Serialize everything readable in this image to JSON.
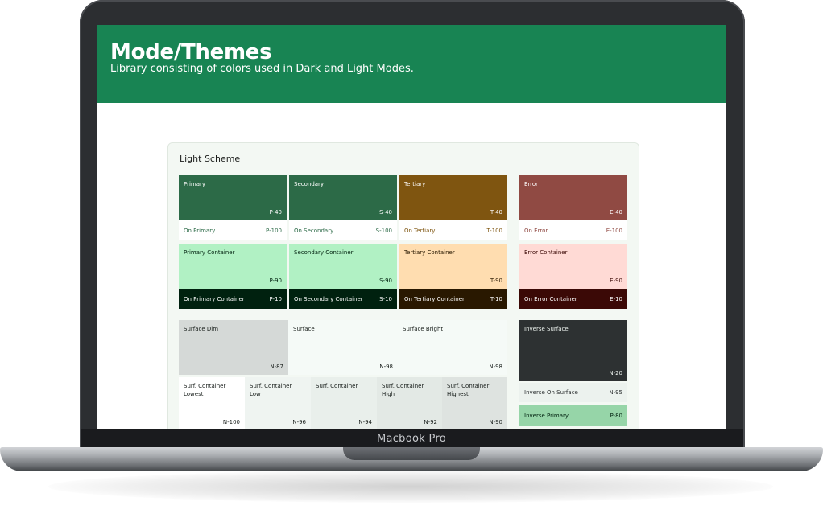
{
  "device_label": "Macbook Pro",
  "header": {
    "title": "Mode/Themes",
    "subtitle": "Library consisting of colors used in Dark and Light Modes."
  },
  "scheme": {
    "title": "Light Scheme",
    "primary": {
      "name": "Primary",
      "code": "P-40",
      "on_name": "On Primary",
      "on_code": "P-100",
      "container_name": "Primary Container",
      "container_code": "P-90",
      "on_container_name": "On Primary Container",
      "on_container_code": "P-10"
    },
    "secondary": {
      "name": "Secondary",
      "code": "S-40",
      "on_name": "On Secondary",
      "on_code": "S-100",
      "container_name": "Secondary Container",
      "container_code": "S-90",
      "on_container_name": "On Secondary Container",
      "on_container_code": "S-10"
    },
    "tertiary": {
      "name": "Tertiary",
      "code": "T-40",
      "on_name": "On Tertiary",
      "on_code": "T-100",
      "container_name": "Tertiary Container",
      "container_code": "T-90",
      "on_container_name": "On Tertiary Container",
      "on_container_code": "T-10"
    },
    "error": {
      "name": "Error",
      "code": "E-40",
      "on_name": "On Error",
      "on_code": "E-100",
      "container_name": "Error Container",
      "container_code": "E-90",
      "on_container_name": "On Error Container",
      "on_container_code": "E-10"
    },
    "surface": {
      "dim_name": "Surface Dim",
      "dim_code": "N-87",
      "name": "Surface",
      "code": "N-98",
      "bright_name": "Surface Bright",
      "bright_code": "N-98",
      "containers": [
        {
          "name": "Surf. Container Lowest",
          "code": "N-100"
        },
        {
          "name": "Surf. Container Low",
          "code": "N-96"
        },
        {
          "name": "Surf. Container",
          "code": "N-94"
        },
        {
          "name": "Surf. Container High",
          "code": "N-92"
        },
        {
          "name": "Surf. Container Highest",
          "code": "N-90"
        }
      ],
      "inverse_name": "Inverse Surface",
      "inverse_code": "N-20",
      "inverse_on_name": "Inverse On Surface",
      "inverse_on_code": "N-95",
      "inverse_primary_name": "Inverse Primary",
      "inverse_primary_code": "P-80"
    }
  },
  "colors": {
    "header_bg": "#188453",
    "primary": "#2c6a47",
    "on_primary": "#ffffff",
    "primary_container": "#b1f1c4",
    "on_primary_container": "#00210f",
    "secondary": "#2c6a47",
    "on_secondary": "#ffffff",
    "secondary_container": "#b1f1c4",
    "on_secondary_container": "#00210f",
    "tertiary": "#7f5510",
    "on_tertiary": "#ffffff",
    "tertiary_container": "#ffddb0",
    "on_tertiary_container": "#291800",
    "error": "#904a43",
    "on_error": "#ffffff",
    "error_container": "#ffdad5",
    "on_error_container": "#3b0906",
    "surface_dim": "#d5d9d7",
    "surface": "#f5faf7",
    "surface_bright": "#f5faf7",
    "surface_containers": [
      "#ffffff",
      "#eff4f1",
      "#e9efeb",
      "#e3e9e5",
      "#dee3e0"
    ],
    "inverse_surface": "#2d3132",
    "inverse_on_surface": "#ecf2ee",
    "inverse_primary": "#96d5a8"
  }
}
